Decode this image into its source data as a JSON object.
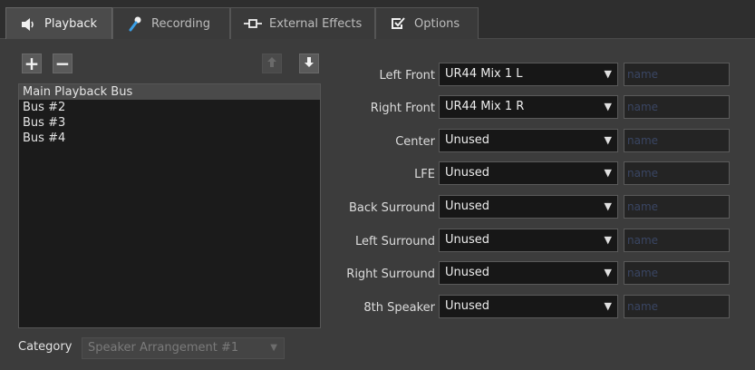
{
  "tabs": [
    {
      "label": "Playback",
      "icon": "speaker-icon"
    },
    {
      "label": "Recording",
      "icon": "microphone-icon"
    },
    {
      "label": "External Effects",
      "icon": "plug-icon"
    },
    {
      "label": "Options",
      "icon": "checkbox-icon"
    }
  ],
  "toolbar": {
    "add_label": "+",
    "remove_label": "−",
    "move_up_icon": "arrow-up-icon",
    "move_down_icon": "arrow-down-icon"
  },
  "buses": [
    "Main Playback Bus",
    "Bus #2",
    "Bus #3",
    "Bus #4"
  ],
  "category": {
    "label": "Category",
    "value": "Speaker Arrangement #1"
  },
  "channels": [
    {
      "label": "Left Front",
      "value": "UR44 Mix 1 L",
      "placeholder": "name"
    },
    {
      "label": "Right Front",
      "value": "UR44 Mix 1 R",
      "placeholder": "name"
    },
    {
      "label": "Center",
      "value": "Unused",
      "placeholder": "name"
    },
    {
      "label": "LFE",
      "value": "Unused",
      "placeholder": "name"
    },
    {
      "label": "Back Surround",
      "value": "Unused",
      "placeholder": "name"
    },
    {
      "label": "Left Surround",
      "value": "Unused",
      "placeholder": "name"
    },
    {
      "label": "Right Surround",
      "value": "Unused",
      "placeholder": "name"
    },
    {
      "label": "8th Speaker",
      "value": "Unused",
      "placeholder": "name"
    }
  ],
  "colors": {
    "background": "#3c3c3c",
    "list_background": "#1b1b1b",
    "active_tab": "#4b4b4b",
    "placeholder_text": "#3a4663"
  }
}
